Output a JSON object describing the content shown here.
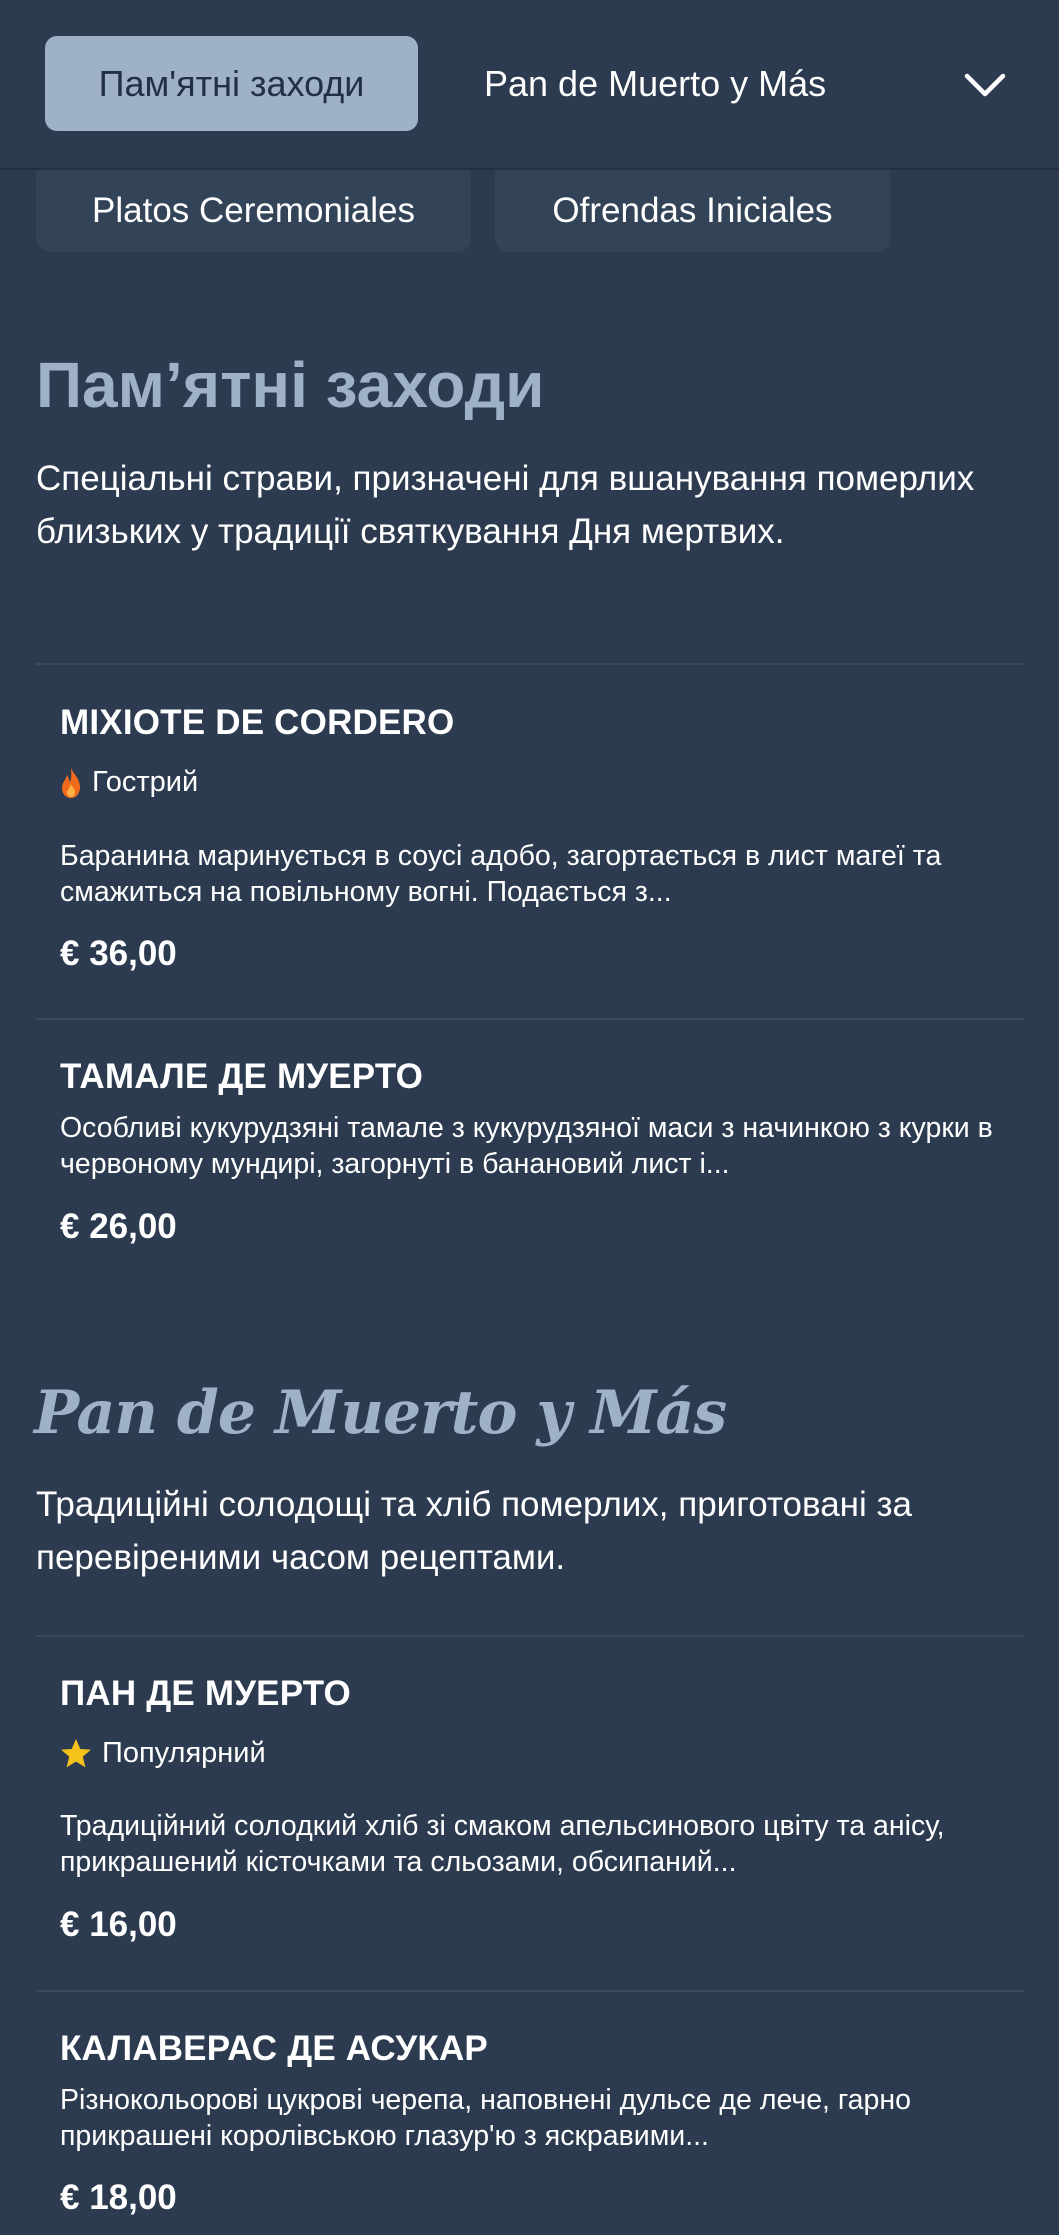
{
  "nav": {
    "active_tab": "Пам'ятні заходи",
    "next_tab": "Pan de Muerto y Más",
    "chips": [
      "Platos Ceremoniales",
      "Ofrendas Iniciales"
    ],
    "menu_icon": "chevron-down-icon"
  },
  "sections": [
    {
      "title": "Пам’ятні заходи",
      "description": "Спеціальні страви, призначені для вшанування померлих близьких у традиції святкування Дня мертвих.",
      "items": [
        {
          "name": "MIXIOTE DE CORDERO",
          "tag": "Гострий",
          "tag_icon": "flame-icon",
          "description": "Баранина маринується в соусі адобо, загортається в лист магеї та смажиться на повільному вогні. Подається з...",
          "price": "€ 36,00"
        },
        {
          "name": "ТАМАЛЕ ДЕ МУЕРТО",
          "description": "Особливі кукурудзяні тамале з кукурудзяної маси з начинкою з курки в червоному мундирі, загорнуті в банановий лист і...",
          "price": "€ 26,00"
        }
      ]
    },
    {
      "title": "Pan de Muerto y Más",
      "description": "Традиційні солодощі та хліб померлих, приготовані за перевіреними часом рецептами.",
      "items": [
        {
          "name": "ПАН ДЕ МУЕРТО",
          "tag": "Популярний",
          "tag_icon": "star-icon",
          "description": "Традиційний солодкий хліб зі смаком апельсинового цвіту та анісу, прикрашений кісточками та сльозами, обсипаний...",
          "price": "€ 16,00"
        },
        {
          "name": "КАЛАВЕРАС ДЕ АСУКАР",
          "description": "Різнокольорові цукрові черепа, наповнені дульсе де лече, гарно прикрашені королівською глазур'ю з яскравими...",
          "price": "€ 18,00"
        }
      ]
    }
  ],
  "colors": {
    "background": "#2c3b4f",
    "accent": "#9fb1c9",
    "flame": "#f26b1d",
    "star": "#f5c21b"
  }
}
